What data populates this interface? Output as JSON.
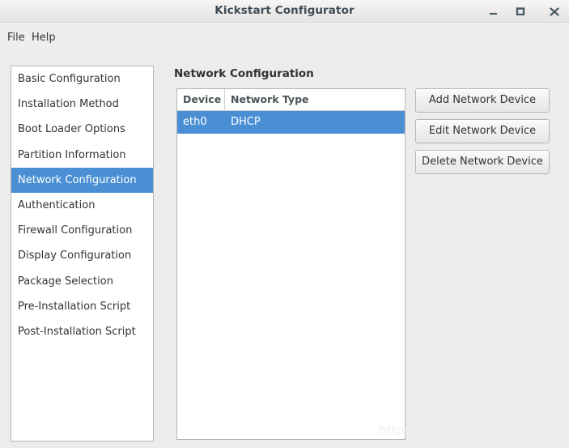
{
  "window": {
    "title": "Kickstart Configurator",
    "controls": [
      {
        "name": "minimize",
        "glyph": "_"
      },
      {
        "name": "maximize",
        "glyph": "square"
      },
      {
        "name": "close",
        "glyph": "x"
      }
    ]
  },
  "menubar": {
    "items": [
      {
        "label": "File"
      },
      {
        "label": "Help"
      }
    ]
  },
  "sidebar": {
    "items": [
      {
        "label": "Basic Configuration",
        "selected": false
      },
      {
        "label": "Installation Method",
        "selected": false
      },
      {
        "label": "Boot Loader Options",
        "selected": false
      },
      {
        "label": "Partition Information",
        "selected": false
      },
      {
        "label": "Network Configuration",
        "selected": true
      },
      {
        "label": "Authentication",
        "selected": false
      },
      {
        "label": "Firewall Configuration",
        "selected": false
      },
      {
        "label": "Display Configuration",
        "selected": false
      },
      {
        "label": "Package Selection",
        "selected": false
      },
      {
        "label": "Pre-Installation Script",
        "selected": false
      },
      {
        "label": "Post-Installation Script",
        "selected": false
      }
    ]
  },
  "main": {
    "heading": "Network Configuration",
    "table": {
      "columns": [
        "Device",
        "Network Type"
      ],
      "rows": [
        {
          "device": "eth0",
          "network_type": "DHCP",
          "selected": true
        }
      ]
    },
    "buttons": [
      {
        "label": "Add Network Device"
      },
      {
        "label": "Edit Network Device"
      },
      {
        "label": "Delete Network Device"
      }
    ]
  },
  "watermark": {
    "text": "https://blog.csdn.net/excellent_L"
  },
  "colors": {
    "selection_blue": "#4a8fd4",
    "window_background": "#edeceb",
    "panel_white": "#ffffff",
    "border_gray": "#b8b6b4",
    "text_dark": "#2e3436",
    "title_text": "#3f4c54"
  }
}
